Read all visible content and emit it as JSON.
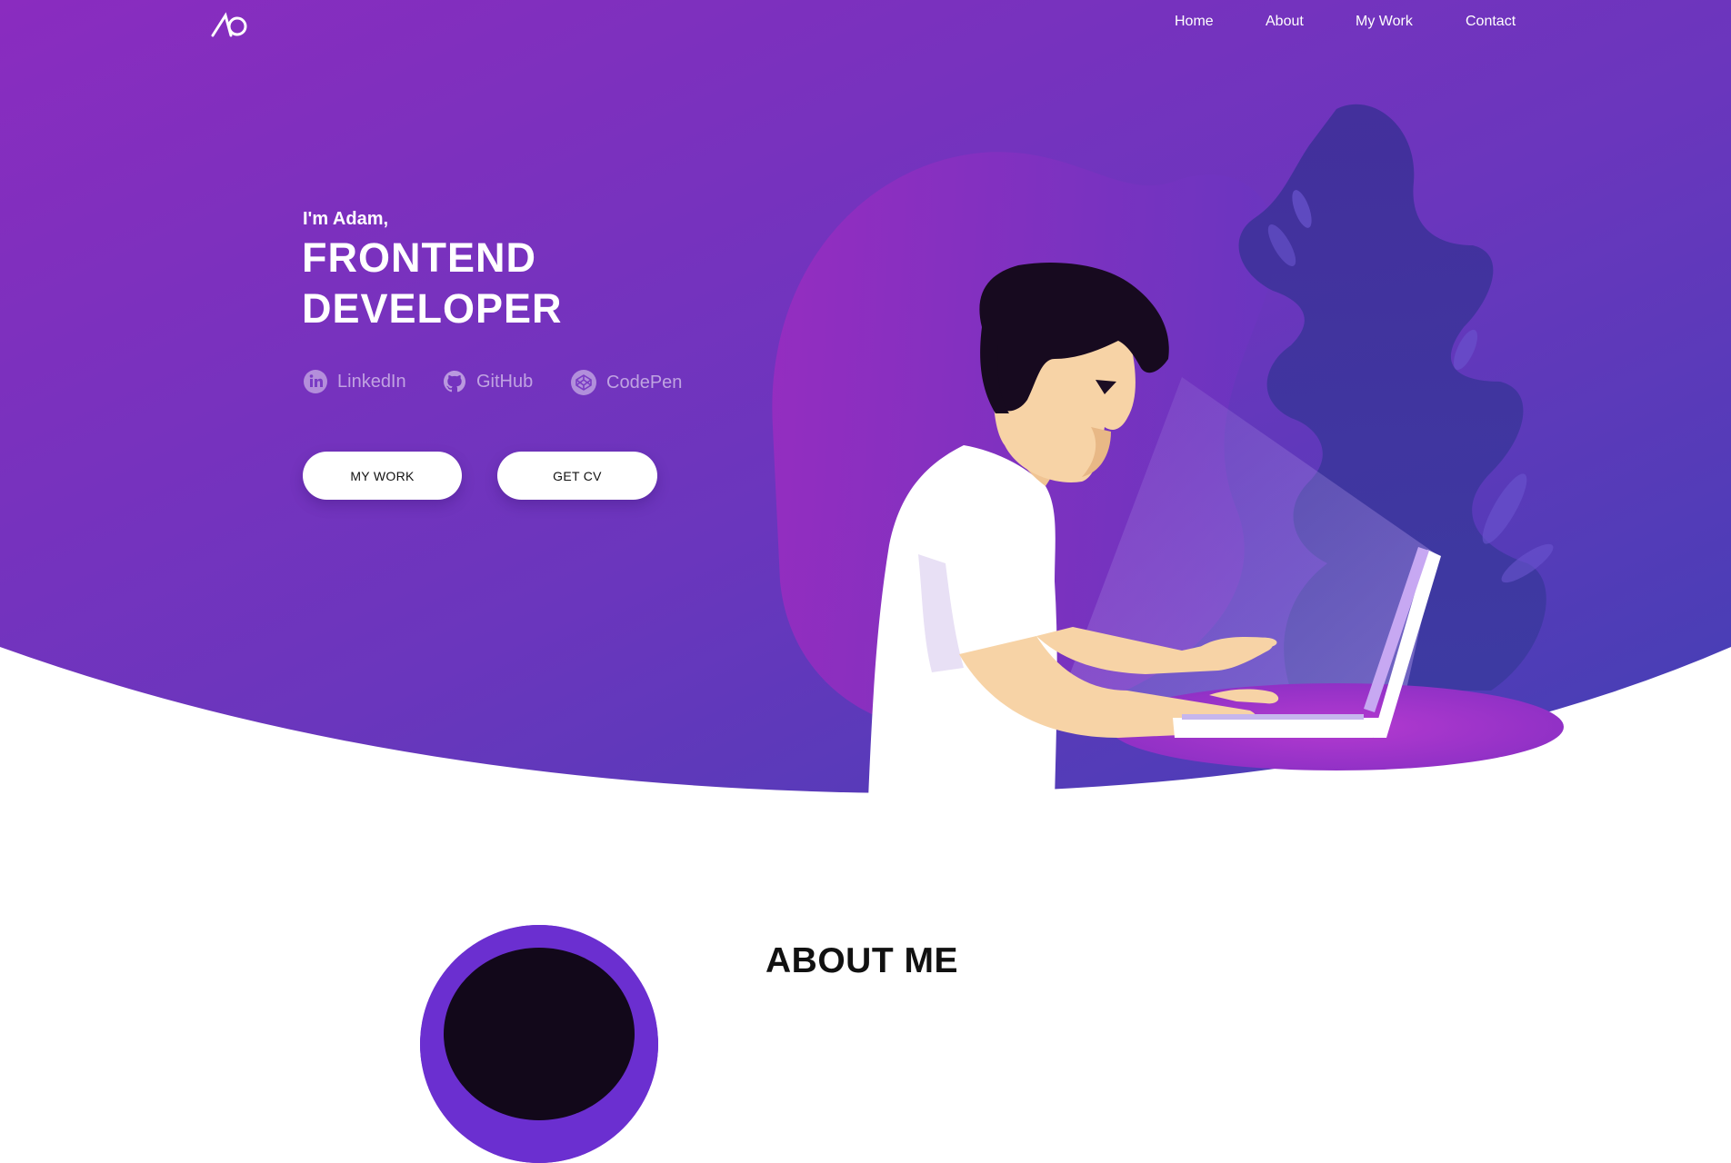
{
  "header": {
    "logo_icon": "ao-monogram-logo",
    "nav": [
      {
        "label": "Home"
      },
      {
        "label": "About"
      },
      {
        "label": "My Work"
      },
      {
        "label": "Contact"
      }
    ]
  },
  "hero": {
    "greeting": "I'm Adam,",
    "title_line1": "FRONTEND",
    "title_line2": "DEVELOPER",
    "socials": [
      {
        "label": "LinkedIn",
        "icon": "linkedin-icon"
      },
      {
        "label": "GitHub",
        "icon": "github-icon"
      },
      {
        "label": "CodePen",
        "icon": "codepen-icon"
      }
    ],
    "buttons": {
      "my_work": "MY WORK",
      "get_cv": "GET CV"
    },
    "illustration": "developer-at-laptop-illustration"
  },
  "about": {
    "title": "ABOUT ME",
    "avatar_icon": "avatar-photo"
  },
  "colors": {
    "gradient_start": "#8a2cbf",
    "gradient_end": "#4b3fb8",
    "text_on_gradient": "#ffffff",
    "button_bg": "#ffffff",
    "social_text": "#c7b3ea"
  }
}
